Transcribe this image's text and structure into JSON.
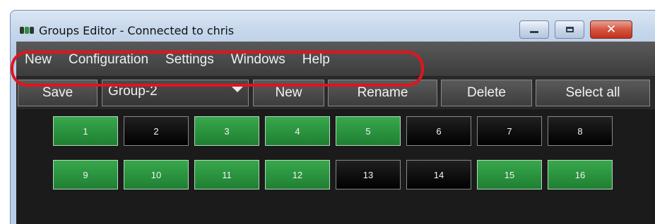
{
  "window": {
    "title": "Groups Editor - Connected to chris",
    "controls": {
      "minimize": "minimize",
      "maximize": "maximize",
      "close": "close"
    }
  },
  "menu": {
    "items": [
      "New",
      "Configuration",
      "Settings",
      "Windows",
      "Help"
    ],
    "highlight_color": "#e4131d"
  },
  "toolbar": {
    "save_label": "Save",
    "group_select": {
      "value": "Group-2"
    },
    "new_label": "New",
    "rename_label": "Rename",
    "delete_label": "Delete",
    "select_all_label": "Select all"
  },
  "channels": [
    {
      "label": "1",
      "state": "on"
    },
    {
      "label": "2",
      "state": "off"
    },
    {
      "label": "3",
      "state": "on"
    },
    {
      "label": "4",
      "state": "on"
    },
    {
      "label": "5",
      "state": "on"
    },
    {
      "label": "6",
      "state": "off"
    },
    {
      "label": "7",
      "state": "off"
    },
    {
      "label": "8",
      "state": "off"
    },
    {
      "label": "9",
      "state": "on"
    },
    {
      "label": "10",
      "state": "on"
    },
    {
      "label": "11",
      "state": "on"
    },
    {
      "label": "12",
      "state": "on"
    },
    {
      "label": "13",
      "state": "off"
    },
    {
      "label": "14",
      "state": "off"
    },
    {
      "label": "15",
      "state": "on"
    },
    {
      "label": "16",
      "state": "on"
    }
  ],
  "colors": {
    "on": "#2a9a3f",
    "off": "#000000",
    "background": "#1b1b1b"
  }
}
